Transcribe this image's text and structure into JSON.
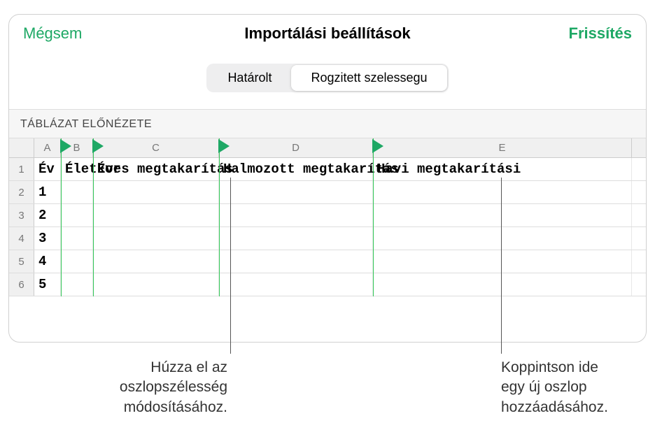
{
  "header": {
    "cancel": "Mégsem",
    "title": "Importálási beállítások",
    "update": "Frissítés"
  },
  "segmented": {
    "opt1": "Határolt",
    "opt2": "Rogzitett szelessegu"
  },
  "section_label": "TÁBLÁZAT ELŐNÉZETE",
  "columns": {
    "a": "A",
    "b": "B",
    "c": "C",
    "d": "D",
    "e": "E"
  },
  "row_nums": {
    "r1": "1",
    "r2": "2",
    "r3": "3",
    "r4": "4",
    "r5": "5",
    "r6": "6"
  },
  "data": {
    "r1a": "Év",
    "r1b": "Életkor",
    "r1c": "Éves megtakarítás",
    "r1d": "Halmozott megtakarítás",
    "r1e": "Havi megtakarítási",
    "r2a": "1",
    "r3a": "2",
    "r4a": "3",
    "r5a": "4",
    "r6a": "5"
  },
  "callouts": {
    "left": "Húzza el az\noszlopszélesség\nmódosításához.",
    "right": "Koppintson ide\negy új oszlop\nhozzáadásához."
  },
  "col_widths": {
    "a": 38,
    "b": 46,
    "c": 180,
    "d": 220,
    "e": 370
  }
}
